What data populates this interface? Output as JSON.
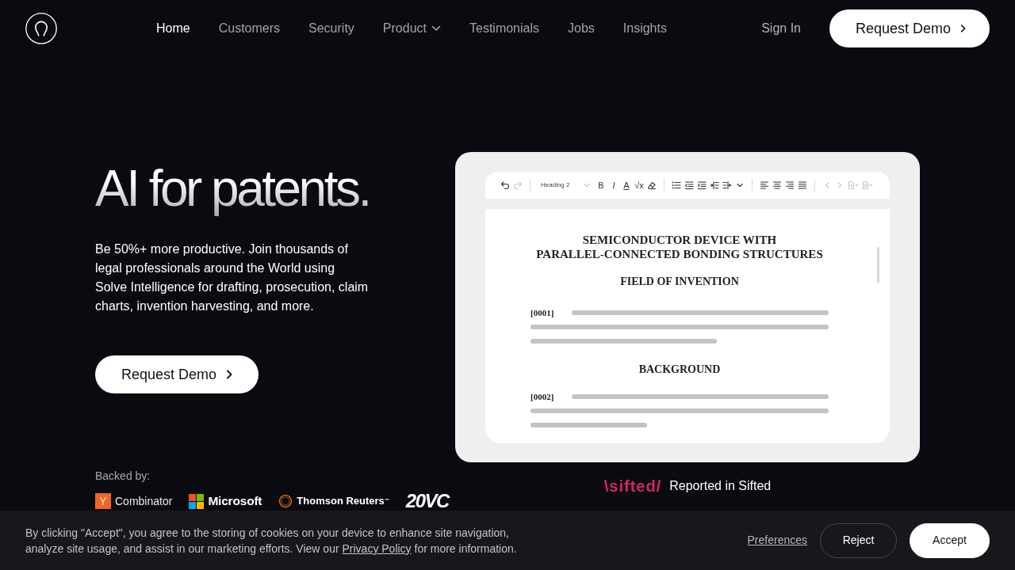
{
  "nav": {
    "items": [
      {
        "label": "Home",
        "selected": true,
        "dropdown": false
      },
      {
        "label": "Customers",
        "selected": false,
        "dropdown": false
      },
      {
        "label": "Security",
        "selected": false,
        "dropdown": false
      },
      {
        "label": "Product",
        "selected": false,
        "dropdown": true
      },
      {
        "label": "Testimonials",
        "selected": false,
        "dropdown": false
      },
      {
        "label": "Jobs",
        "selected": false,
        "dropdown": false
      },
      {
        "label": "Insights",
        "selected": false,
        "dropdown": false
      }
    ],
    "sign_in": "Sign In",
    "cta": "Request Demo"
  },
  "hero": {
    "title": "AI for patents.",
    "description": "Be 50%+ more productive. Join thousands of legal professionals around the World using Solve Intelligence for drafting, prosecution, claim charts, invention harvesting, and more.",
    "cta": "Request Demo",
    "backed_by": {
      "label": "Backed by:",
      "logos": [
        {
          "kind": "lettermark",
          "mark": "Y",
          "name": "Combinator"
        },
        {
          "kind": "squares",
          "name": "Microsoft"
        },
        {
          "kind": "ring",
          "name": "Thomson Reuters$^{™}$"
        },
        {
          "kind": "wordmark",
          "name": "20VC"
        }
      ]
    }
  },
  "editor": {
    "toolbar": {
      "undo": {
        "disabled": false
      },
      "redo": {
        "disabled": true
      },
      "block_style": "Heading 2",
      "format_buttons": [
        {
          "kind": "bold",
          "label": "B"
        },
        {
          "kind": "italic",
          "label": "I"
        },
        {
          "kind": "color",
          "label": "A"
        },
        {
          "kind": "formula",
          "label": "√x"
        }
      ],
      "navigation": {
        "disabled": true
      },
      "insert": {
        "disabled": true
      }
    },
    "document": {
      "title": "SEMICONDUCTOR DEVICE WITH PARALLEL-CONNECTED BONDING STRUCTURES",
      "sections": [
        {
          "heading": "FIELD OF INVENTION",
          "paragraphs": [
            {
              "number": "[0001]"
            }
          ]
        },
        {
          "heading": "BACKGROUND",
          "paragraphs": [
            {
              "number": "[0002]"
            }
          ]
        }
      ]
    }
  },
  "press": {
    "logo": "\\sifted/",
    "text": "Reported in Sifted"
  },
  "cookie_banner": {
    "text_before": "By clicking \"Accept\", you agree to the storing of cookies on your device to enhance site navigation, analyze site usage, and assist in our marketing efforts. View our",
    "link": "Privacy Policy",
    "text_after": "for more information.",
    "preferences": "Preferences",
    "buttons": [
      {
        "kind": "reject",
        "label": "Reject"
      },
      {
        "kind": "accept",
        "label": "Accept"
      }
    ]
  }
}
